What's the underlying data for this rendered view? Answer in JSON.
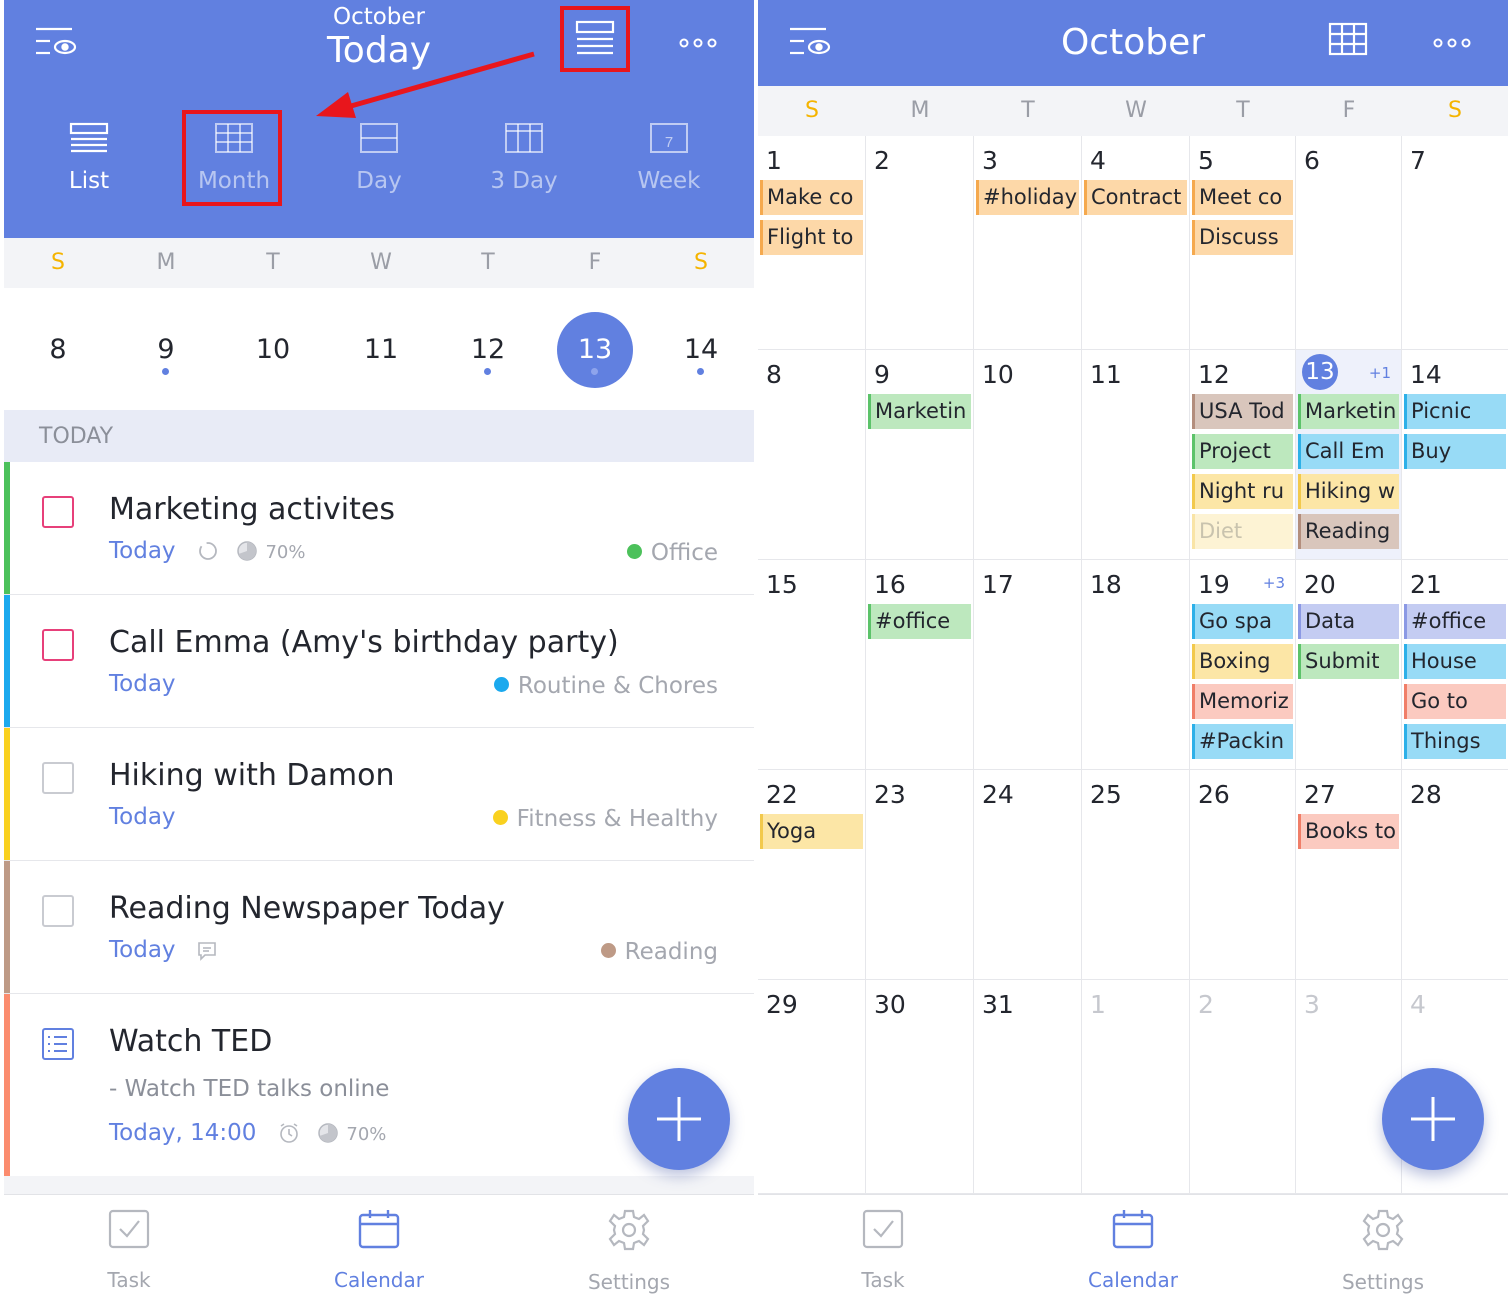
{
  "left": {
    "header": {
      "month": "October",
      "title": "Today"
    },
    "view_options": [
      "List",
      "Month",
      "Day",
      "3 Day",
      "Week"
    ],
    "week_icon_number": "7",
    "week_letters": [
      "S",
      "M",
      "T",
      "W",
      "T",
      "F",
      "S"
    ],
    "week_dates": [
      "8",
      "9",
      "10",
      "11",
      "12",
      "13",
      "14"
    ],
    "section": "TODAY",
    "tasks": [
      {
        "title": "Marketing activites",
        "date": "Today",
        "progress": "70%",
        "project": "Office",
        "color": "#4CC15B",
        "check": "#E7407A"
      },
      {
        "title": "Call Emma (Amy's birthday party)",
        "date": "Today",
        "project": "Routine & Chores",
        "color": "#1BA9EE",
        "check": "#E7407A"
      },
      {
        "title": "Hiking with Damon",
        "date": "Today",
        "project": "Fitness & Healthy",
        "color": "#F9D11F",
        "check": "#C9CBD1"
      },
      {
        "title": "Reading Newspaper Today",
        "date": "Today",
        "project": "Reading",
        "color": "#BE9A86",
        "check": "#C9CBD1"
      },
      {
        "title": "Watch TED",
        "subtitle": "- Watch TED talks online",
        "date": "Today, 14:00",
        "progress": "70%",
        "color": "#FB8C6E"
      }
    ]
  },
  "right": {
    "header": {
      "title": "October"
    },
    "week_letters": [
      "S",
      "M",
      "T",
      "W",
      "T",
      "F",
      "S"
    ],
    "weeks": [
      [
        "1",
        "2",
        "3",
        "4",
        "5",
        "6",
        "7"
      ],
      [
        "8",
        "9",
        "10",
        "11",
        "12",
        "13",
        "14"
      ],
      [
        "15",
        "16",
        "17",
        "18",
        "19",
        "20",
        "21"
      ],
      [
        "22",
        "23",
        "24",
        "25",
        "26",
        "27",
        "28"
      ],
      [
        "29",
        "30",
        "31",
        "1",
        "2",
        "3",
        "4"
      ]
    ],
    "more_badges": {
      "w1c5": "+1",
      "w2c4": "+3"
    },
    "events": [
      {
        "w": 0,
        "c": 0,
        "r": 0,
        "text": "Make co",
        "color": "orange"
      },
      {
        "w": 0,
        "c": 0,
        "r": 1,
        "text": "Flight to",
        "color": "orange"
      },
      {
        "w": 0,
        "c": 2,
        "r": 0,
        "text": "#holiday",
        "color": "orange"
      },
      {
        "w": 0,
        "c": 3,
        "r": 0,
        "text": "Contract",
        "color": "orange"
      },
      {
        "w": 0,
        "c": 4,
        "r": 0,
        "text": "Meet co",
        "color": "orange"
      },
      {
        "w": 0,
        "c": 4,
        "r": 1,
        "text": "Discuss",
        "color": "orange"
      },
      {
        "w": 1,
        "c": 1,
        "r": 0,
        "text": "Marketin",
        "color": "green"
      },
      {
        "w": 1,
        "c": 4,
        "r": 0,
        "text": "USA Tod",
        "color": "brown"
      },
      {
        "w": 1,
        "c": 4,
        "r": 1,
        "text": "Project",
        "color": "green"
      },
      {
        "w": 1,
        "c": 4,
        "r": 2,
        "text": "Night ru",
        "color": "yellow"
      },
      {
        "w": 1,
        "c": 4,
        "r": 3,
        "text": "Diet",
        "color": "faint"
      },
      {
        "w": 1,
        "c": 5,
        "r": 0,
        "text": "Marketin",
        "color": "green"
      },
      {
        "w": 1,
        "c": 5,
        "r": 1,
        "text": "Call Em",
        "color": "blue"
      },
      {
        "w": 1,
        "c": 5,
        "r": 2,
        "text": "Hiking w",
        "color": "yellow"
      },
      {
        "w": 1,
        "c": 5,
        "r": 3,
        "text": "Reading",
        "color": "brown"
      },
      {
        "w": 1,
        "c": 6,
        "r": 0,
        "text": "Picnic",
        "color": "blue"
      },
      {
        "w": 1,
        "c": 6,
        "r": 1,
        "text": "Buy",
        "color": "blue"
      },
      {
        "w": 2,
        "c": 1,
        "r": 0,
        "text": "#office",
        "color": "green"
      },
      {
        "w": 2,
        "c": 4,
        "r": 0,
        "text": "Go spa",
        "color": "blue"
      },
      {
        "w": 2,
        "c": 4,
        "r": 1,
        "text": "Boxing",
        "color": "yellow"
      },
      {
        "w": 2,
        "c": 4,
        "r": 2,
        "text": "Memoriz",
        "color": "red"
      },
      {
        "w": 2,
        "c": 4,
        "r": 3,
        "text": "#Packin",
        "color": "blue"
      },
      {
        "w": 2,
        "c": 5,
        "r": 0,
        "text": "Data",
        "color": "lilac"
      },
      {
        "w": 2,
        "c": 5,
        "r": 1,
        "text": "Submit",
        "color": "green"
      },
      {
        "w": 2,
        "c": 6,
        "r": 0,
        "text": "#office",
        "color": "lilac"
      },
      {
        "w": 2,
        "c": 6,
        "r": 1,
        "text": "House",
        "color": "blue"
      },
      {
        "w": 2,
        "c": 6,
        "r": 2,
        "text": "Go to",
        "color": "red"
      },
      {
        "w": 2,
        "c": 6,
        "r": 3,
        "text": "Things",
        "color": "blue"
      },
      {
        "w": 3,
        "c": 0,
        "r": 0,
        "text": "Yoga",
        "color": "yellow"
      },
      {
        "w": 3,
        "c": 5,
        "r": 0,
        "text": "Books to",
        "color": "red"
      }
    ]
  },
  "tabbar": [
    "Task",
    "Calendar",
    "Settings"
  ],
  "colors": {
    "accent": "#6180E0",
    "weekend": "#F5B400",
    "highlight": "#E8161C"
  }
}
